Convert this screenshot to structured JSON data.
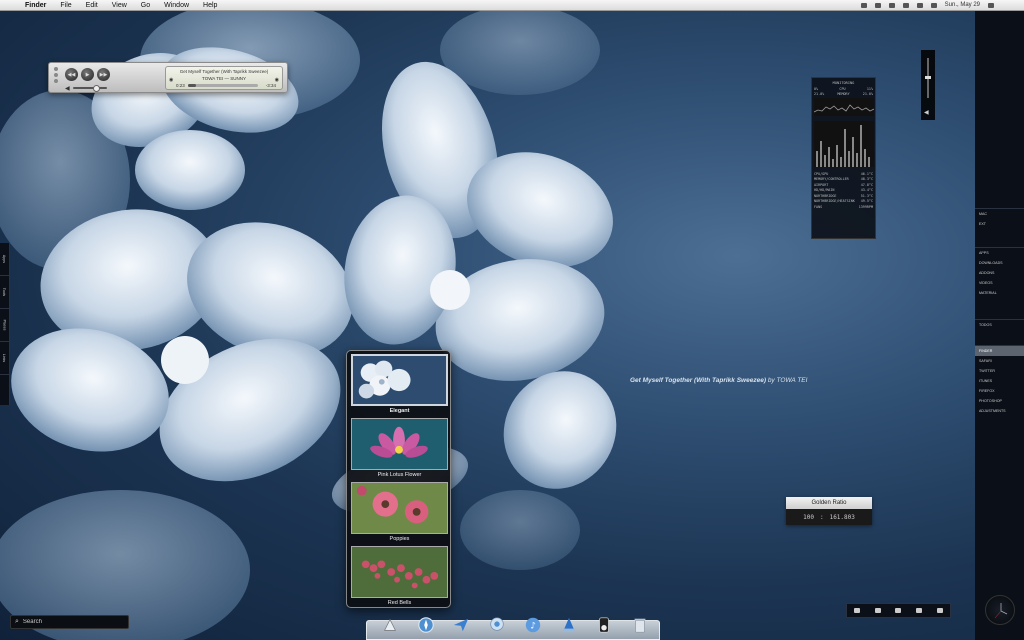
{
  "menubar": {
    "items": [
      "Finder",
      "File",
      "Edit",
      "View",
      "Go",
      "Window",
      "Help"
    ],
    "clock": "Sun., May 29"
  },
  "player": {
    "song_title": "Get Myself Together (With Taprikk Sweezee)",
    "artist_album": "TOWA TEI — SUNNY",
    "elapsed": "0:23",
    "remaining": "-3:34",
    "progress": 0.12
  },
  "monitor": {
    "title": "MONITORING",
    "rows_top": [
      [
        "0%",
        "CPU",
        "11%"
      ],
      [
        "21.0%",
        "MEMORY",
        "21.0%"
      ]
    ],
    "rows_bottom": [
      [
        "CPU/GPU",
        "46.1°C"
      ],
      [
        "MEMORY/CONTROLLER",
        "48.3°C"
      ],
      [
        "AIRPORT",
        "47.8°C"
      ],
      [
        "HD/HD/MAIN",
        "43.4°C"
      ],
      [
        "NORTHBRIDGE",
        "51.3°C"
      ],
      [
        "NORTHBRIDGE/HEATSINK",
        "49.5°C"
      ],
      [
        "FANS",
        "1399RPM"
      ]
    ]
  },
  "sidebar": {
    "group1": [
      "Mac",
      "Ext"
    ],
    "group2": [
      "Apps",
      "Downloads",
      "Addons",
      "Videos",
      "Material"
    ],
    "group3": [
      "Todos"
    ],
    "group4": [
      "Finder",
      "Safari",
      "Twitter",
      "iTunes",
      "Firefox",
      "Photoshop",
      "Adjustments"
    ],
    "selected": "Finder"
  },
  "lefttabs": [
    "Apps",
    "Tools",
    "Places",
    "Links"
  ],
  "song_label": {
    "title": "Get Myself Together (With Taprikk Sweezee)",
    "by": "by",
    "artist": "TOWA TEI"
  },
  "golden_ratio": {
    "title": "Golden Ratio",
    "left": "100",
    "separator": ":",
    "right": "161.803"
  },
  "stack": {
    "items": [
      {
        "label": "Elegant",
        "selected": true
      },
      {
        "label": "Pink Lotus Flower",
        "selected": false
      },
      {
        "label": "Poppies",
        "selected": false
      },
      {
        "label": "Red Bells",
        "selected": false
      }
    ]
  },
  "dock": {
    "icons": [
      "finder-icon",
      "safari-icon",
      "mail-icon",
      "ichat-icon",
      "itunes-icon",
      "app-store-icon",
      "ipod-icon",
      "trash-icon"
    ]
  },
  "search": {
    "placeholder": "Search"
  },
  "colors": {
    "wallpaper_dark": "#10223a",
    "wallpaper_light": "#4c6f93",
    "sidebar_bg": "#0b1018",
    "sidebar_selected": "#5c6470"
  }
}
